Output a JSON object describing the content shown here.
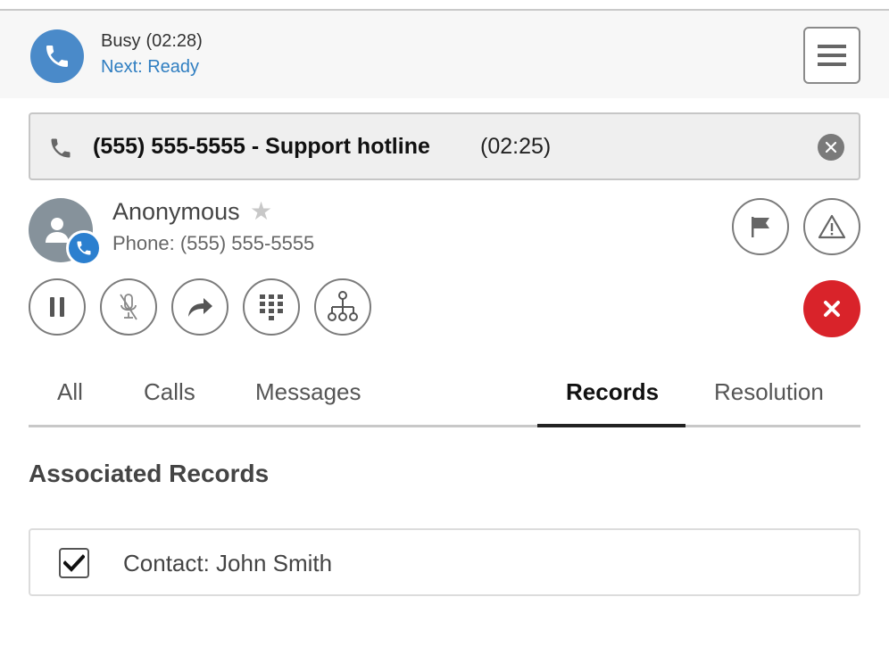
{
  "status": {
    "state": "Busy",
    "timer": "(02:28)",
    "next": "Next: Ready",
    "avatar_icon": "phone-icon",
    "menu_icon": "hamburger-menu-icon"
  },
  "active_call": {
    "title": "(555) 555-5555 - Support hotline",
    "timer": "(02:25)",
    "icon": "phone-icon",
    "close_icon": "close-icon"
  },
  "contact": {
    "name": "Anonymous",
    "phone": "Phone: (555) 555-5555",
    "star_glyph": "★",
    "avatar_icon": "user-icon",
    "badge_icon": "phone-icon"
  },
  "actions": {
    "flag_icon": "flag-icon",
    "warning_icon": "warning-icon",
    "hold_icon": "pause-icon",
    "mute_icon": "microphone-muted-icon",
    "transfer_icon": "forward-arrow-icon",
    "keypad_icon": "dialpad-icon",
    "conference_icon": "hierarchy-icon",
    "hangup_icon": "close-icon"
  },
  "tabs": [
    {
      "label": "All",
      "active": false
    },
    {
      "label": "Calls",
      "active": false
    },
    {
      "label": "Messages",
      "active": false
    },
    {
      "label": "Records",
      "active": true
    },
    {
      "label": "Resolution",
      "active": false
    }
  ],
  "records": {
    "section_title": "Associated Records",
    "items": [
      {
        "label": "Contact: John Smith",
        "checked": true
      }
    ]
  },
  "colors": {
    "accent_blue": "#2f7ec1",
    "hangup_red": "#d9232a",
    "avatar_blue": "#4a8ac9",
    "contact_avatar_gray": "#86929b"
  }
}
